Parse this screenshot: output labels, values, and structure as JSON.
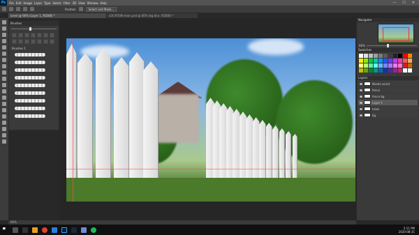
{
  "titlebar": {
    "logo": "Ps",
    "menu": [
      "File",
      "Edit",
      "Image",
      "Layer",
      "Type",
      "Select",
      "Filter",
      "3D",
      "View",
      "Window",
      "Help"
    ],
    "min": "—",
    "max": "☐",
    "close": "✕"
  },
  "options": {
    "mode_label": "Position",
    "select_label": "Select and Mask..."
  },
  "document": {
    "tab_title": "Level @ 66% (Layer 1, RGB/8) *",
    "tab2_title": "LOCATION-main.psd @ 66% (bg blur, RGB/8) *"
  },
  "brushes": {
    "title": "Brushes",
    "folder": "Brushes 1"
  },
  "navigator": {
    "title": "Navigator",
    "zoom": "66%"
  },
  "swatches": {
    "title": "Swatches",
    "colors": [
      "#ffffff",
      "#e0e0e0",
      "#bdbdbd",
      "#9e9e9e",
      "#7a7a7a",
      "#5a5a5a",
      "#3c3c3c",
      "#222222",
      "#000000",
      "#ff0000",
      "#ff8800",
      "#ffee00",
      "#88ee00",
      "#00cc44",
      "#00ccaa",
      "#0099ff",
      "#2255ff",
      "#7733ff",
      "#cc33ff",
      "#ff33aa",
      "#ff5555",
      "#ffaa55",
      "#ffff88",
      "#bbff77",
      "#66ee99",
      "#66ffee",
      "#66bbff",
      "#7788ff",
      "#aa77ff",
      "#ee77ff",
      "#ff77cc",
      "#cc2222",
      "#cc6600",
      "#ccbb00",
      "#66aa00",
      "#008833",
      "#009988",
      "#0066cc",
      "#1133aa",
      "#5522aa",
      "#992299",
      "#cc2266",
      "#ffffff",
      "#f5f5f5"
    ]
  },
  "layers": {
    "title": "Layers",
    "items": [
      {
        "name": "Needs assist",
        "selected": false
      },
      {
        "name": "fence",
        "selected": false
      },
      {
        "name": "fence bg",
        "selected": false
      },
      {
        "name": "Layer 1",
        "selected": true
      },
      {
        "name": "trees",
        "selected": false
      },
      {
        "name": "bg",
        "selected": false
      }
    ]
  },
  "status": {
    "zoom": "66%"
  },
  "taskbar": {
    "time": "2:11 PM",
    "date": "2020-08-31"
  }
}
